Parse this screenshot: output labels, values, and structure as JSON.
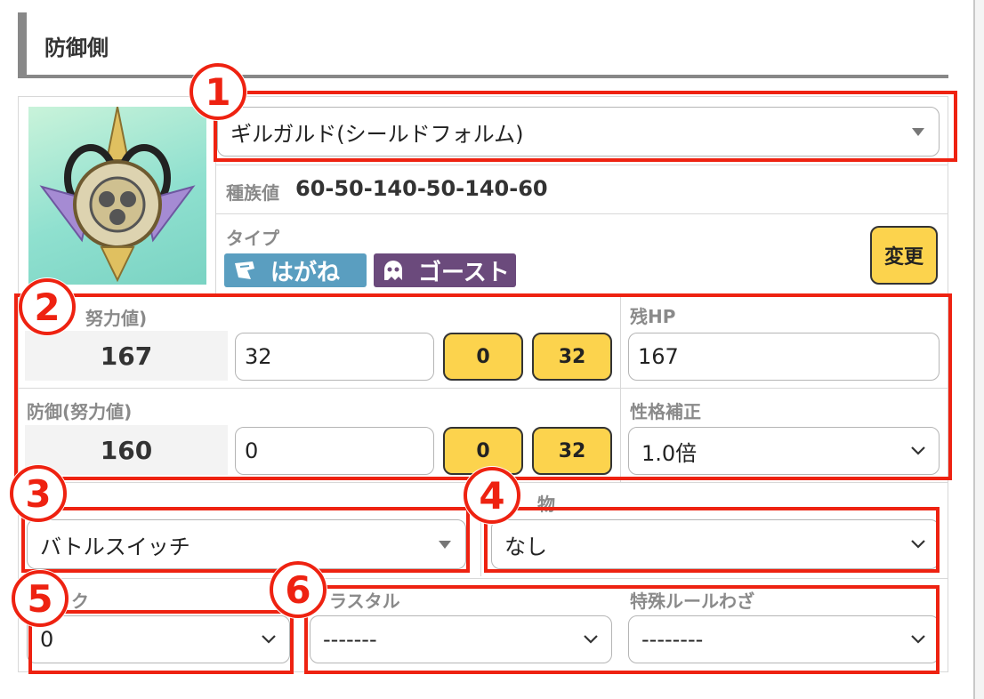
{
  "header": {
    "title": "防御側"
  },
  "pokemon": {
    "name": "ギルガルド(シールドフォルム)",
    "base_stats_label": "種族値",
    "base_stats": "60-50-140-50-140-60",
    "type_label": "タイプ",
    "types": [
      {
        "name": "はがね",
        "color": "#5a9ec0"
      },
      {
        "name": "ゴースト",
        "color": "#6b4a7c"
      }
    ],
    "change_button": "変更"
  },
  "hp": {
    "label": "努力値)",
    "stat": "167",
    "ev": "32",
    "btn_min": "0",
    "btn_max": "32"
  },
  "remaining_hp": {
    "label": "残HP",
    "value": "167"
  },
  "defense": {
    "label": "防御(努力値)",
    "stat": "160",
    "ev": "0",
    "btn_min": "0",
    "btn_max": "32"
  },
  "nature": {
    "label": "性格補正",
    "value": "1.0倍"
  },
  "ability": {
    "value": "バトルスイッチ"
  },
  "item": {
    "label": "物",
    "value": "なし"
  },
  "rank": {
    "label": "ク",
    "value": "0"
  },
  "terastal": {
    "label": "ラスタル",
    "value": "-------"
  },
  "special_move": {
    "label": "特殊ルールわざ",
    "value": "--------"
  },
  "markers": [
    "1",
    "2",
    "3",
    "4",
    "5",
    "6"
  ],
  "colors": {
    "annotation_red": "#ee2211",
    "button_yellow": "#fcd34d",
    "steel": "#5a9ec0",
    "ghost": "#6b4a7c"
  }
}
